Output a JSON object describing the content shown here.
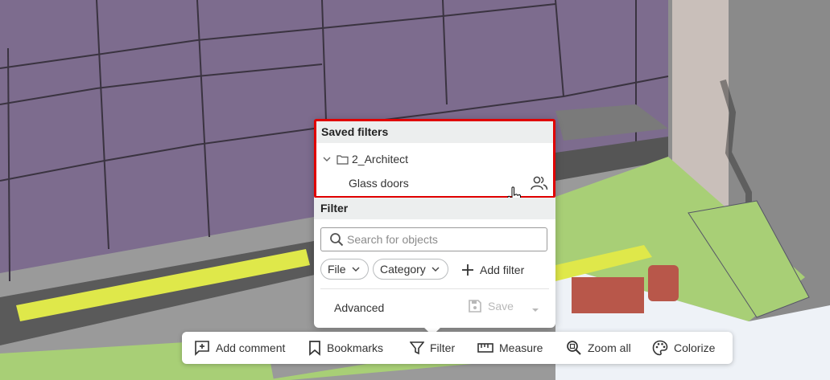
{
  "saved_filters": {
    "header": "Saved filters",
    "folder": {
      "name": "2_Architect",
      "expanded": true
    },
    "items": [
      {
        "label": "Glass doors",
        "shared": true
      }
    ]
  },
  "filter": {
    "header": "Filter",
    "search": {
      "placeholder": "Search for objects",
      "value": ""
    },
    "chips": [
      {
        "label": "File"
      },
      {
        "label": "Category"
      }
    ],
    "add_filter_label": "Add filter",
    "advanced_label": "Advanced",
    "save_label": "Save"
  },
  "toolbar": {
    "items": [
      {
        "label": "Add comment",
        "icon": "add-comment-icon"
      },
      {
        "label": "Bookmarks",
        "icon": "bookmark-icon"
      },
      {
        "label": "Filter",
        "icon": "filter-icon"
      },
      {
        "label": "Measure",
        "icon": "ruler-icon"
      },
      {
        "label": "Zoom all",
        "icon": "zoom-icon"
      },
      {
        "label": "Colorize",
        "icon": "palette-icon"
      }
    ]
  },
  "colors": {
    "highlight_border": "#e00000",
    "wall": "#7b6b8f",
    "floor": "#a8cf76",
    "yellow": "#e6f04b"
  }
}
